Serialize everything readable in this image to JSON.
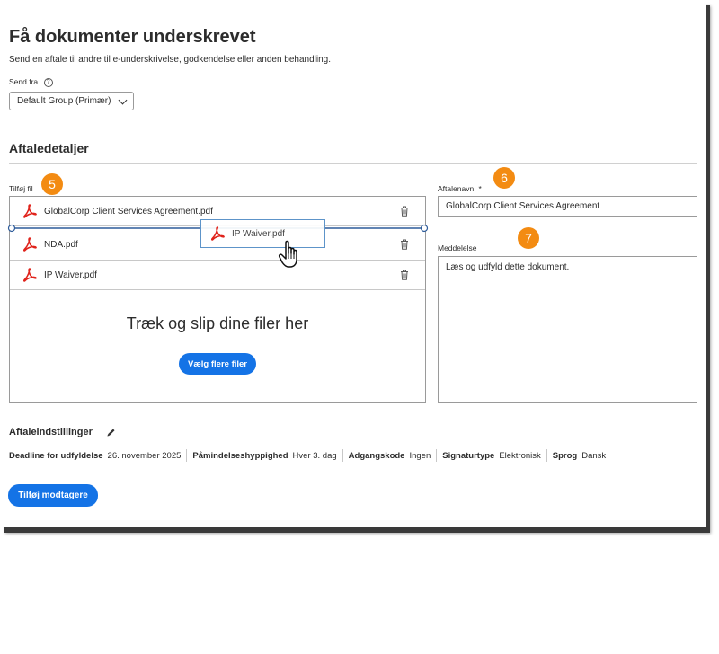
{
  "page": {
    "title": "Få dokumenter underskrevet",
    "subtitle": "Send en aftale til andre til e-underskrivelse, godkendelse eller anden behandling."
  },
  "send_from": {
    "label": "Send fra",
    "help_glyph": "?",
    "selected": "Default Group (Primær)"
  },
  "details": {
    "heading": "Aftaledetaljer"
  },
  "files": {
    "label": "Tilføj fil",
    "items": [
      {
        "name": "GlobalCorp Client Services Agreement.pdf"
      },
      {
        "name": "NDA.pdf"
      },
      {
        "name": "IP Waiver.pdf"
      }
    ],
    "drag_ghost": "IP Waiver.pdf",
    "drop_text": "Træk og slip dine filer her",
    "choose_button": "Vælg flere filer"
  },
  "agreement": {
    "name_label": "Aftalenavn",
    "required_mark": "*",
    "name_value": "GlobalCorp Client Services Agreement",
    "message_label": "Meddelelse",
    "message_value": "Læs og udfyld dette dokument."
  },
  "callouts": [
    "5",
    "6",
    "7"
  ],
  "settings": {
    "heading": "Aftaleindstillinger",
    "items": [
      {
        "key": "Deadline for udfyldelse",
        "value": "26. november 2025"
      },
      {
        "key": "Påmindelseshyppighed",
        "value": "Hver 3. dag"
      },
      {
        "key": "Adgangskode",
        "value": "Ingen"
      },
      {
        "key": "Signaturtype",
        "value": "Elektronisk"
      },
      {
        "key": "Sprog",
        "value": "Dansk"
      }
    ]
  },
  "actions": {
    "add_recipients": "Tilføj modtagere"
  },
  "colors": {
    "accent": "#1473e6",
    "callout": "#f38b12",
    "pdf_red": "#e0231b"
  },
  "icons": {
    "pdf": "adobe-pdf-icon",
    "trash": "trash-icon",
    "edit": "pencil-icon",
    "cursor": "hand-grab-cursor-icon",
    "help": "question-circle-icon",
    "dropdown": "chevron-down-icon"
  }
}
